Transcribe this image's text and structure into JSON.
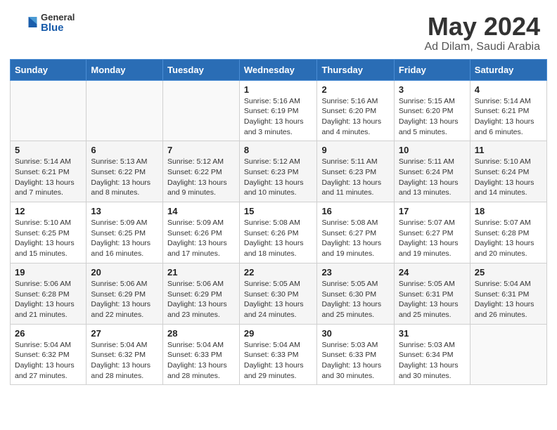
{
  "header": {
    "logo_general": "General",
    "logo_blue": "Blue",
    "title": "May 2024",
    "subtitle": "Ad Dilam, Saudi Arabia"
  },
  "days_of_week": [
    "Sunday",
    "Monday",
    "Tuesday",
    "Wednesday",
    "Thursday",
    "Friday",
    "Saturday"
  ],
  "weeks": [
    [
      {
        "day": "",
        "info": ""
      },
      {
        "day": "",
        "info": ""
      },
      {
        "day": "",
        "info": ""
      },
      {
        "day": "1",
        "info": "Sunrise: 5:16 AM\nSunset: 6:19 PM\nDaylight: 13 hours and 3 minutes."
      },
      {
        "day": "2",
        "info": "Sunrise: 5:16 AM\nSunset: 6:20 PM\nDaylight: 13 hours and 4 minutes."
      },
      {
        "day": "3",
        "info": "Sunrise: 5:15 AM\nSunset: 6:20 PM\nDaylight: 13 hours and 5 minutes."
      },
      {
        "day": "4",
        "info": "Sunrise: 5:14 AM\nSunset: 6:21 PM\nDaylight: 13 hours and 6 minutes."
      }
    ],
    [
      {
        "day": "5",
        "info": "Sunrise: 5:14 AM\nSunset: 6:21 PM\nDaylight: 13 hours and 7 minutes."
      },
      {
        "day": "6",
        "info": "Sunrise: 5:13 AM\nSunset: 6:22 PM\nDaylight: 13 hours and 8 minutes."
      },
      {
        "day": "7",
        "info": "Sunrise: 5:12 AM\nSunset: 6:22 PM\nDaylight: 13 hours and 9 minutes."
      },
      {
        "day": "8",
        "info": "Sunrise: 5:12 AM\nSunset: 6:23 PM\nDaylight: 13 hours and 10 minutes."
      },
      {
        "day": "9",
        "info": "Sunrise: 5:11 AM\nSunset: 6:23 PM\nDaylight: 13 hours and 11 minutes."
      },
      {
        "day": "10",
        "info": "Sunrise: 5:11 AM\nSunset: 6:24 PM\nDaylight: 13 hours and 13 minutes."
      },
      {
        "day": "11",
        "info": "Sunrise: 5:10 AM\nSunset: 6:24 PM\nDaylight: 13 hours and 14 minutes."
      }
    ],
    [
      {
        "day": "12",
        "info": "Sunrise: 5:10 AM\nSunset: 6:25 PM\nDaylight: 13 hours and 15 minutes."
      },
      {
        "day": "13",
        "info": "Sunrise: 5:09 AM\nSunset: 6:25 PM\nDaylight: 13 hours and 16 minutes."
      },
      {
        "day": "14",
        "info": "Sunrise: 5:09 AM\nSunset: 6:26 PM\nDaylight: 13 hours and 17 minutes."
      },
      {
        "day": "15",
        "info": "Sunrise: 5:08 AM\nSunset: 6:26 PM\nDaylight: 13 hours and 18 minutes."
      },
      {
        "day": "16",
        "info": "Sunrise: 5:08 AM\nSunset: 6:27 PM\nDaylight: 13 hours and 19 minutes."
      },
      {
        "day": "17",
        "info": "Sunrise: 5:07 AM\nSunset: 6:27 PM\nDaylight: 13 hours and 19 minutes."
      },
      {
        "day": "18",
        "info": "Sunrise: 5:07 AM\nSunset: 6:28 PM\nDaylight: 13 hours and 20 minutes."
      }
    ],
    [
      {
        "day": "19",
        "info": "Sunrise: 5:06 AM\nSunset: 6:28 PM\nDaylight: 13 hours and 21 minutes."
      },
      {
        "day": "20",
        "info": "Sunrise: 5:06 AM\nSunset: 6:29 PM\nDaylight: 13 hours and 22 minutes."
      },
      {
        "day": "21",
        "info": "Sunrise: 5:06 AM\nSunset: 6:29 PM\nDaylight: 13 hours and 23 minutes."
      },
      {
        "day": "22",
        "info": "Sunrise: 5:05 AM\nSunset: 6:30 PM\nDaylight: 13 hours and 24 minutes."
      },
      {
        "day": "23",
        "info": "Sunrise: 5:05 AM\nSunset: 6:30 PM\nDaylight: 13 hours and 25 minutes."
      },
      {
        "day": "24",
        "info": "Sunrise: 5:05 AM\nSunset: 6:31 PM\nDaylight: 13 hours and 25 minutes."
      },
      {
        "day": "25",
        "info": "Sunrise: 5:04 AM\nSunset: 6:31 PM\nDaylight: 13 hours and 26 minutes."
      }
    ],
    [
      {
        "day": "26",
        "info": "Sunrise: 5:04 AM\nSunset: 6:32 PM\nDaylight: 13 hours and 27 minutes."
      },
      {
        "day": "27",
        "info": "Sunrise: 5:04 AM\nSunset: 6:32 PM\nDaylight: 13 hours and 28 minutes."
      },
      {
        "day": "28",
        "info": "Sunrise: 5:04 AM\nSunset: 6:33 PM\nDaylight: 13 hours and 28 minutes."
      },
      {
        "day": "29",
        "info": "Sunrise: 5:04 AM\nSunset: 6:33 PM\nDaylight: 13 hours and 29 minutes."
      },
      {
        "day": "30",
        "info": "Sunrise: 5:03 AM\nSunset: 6:33 PM\nDaylight: 13 hours and 30 minutes."
      },
      {
        "day": "31",
        "info": "Sunrise: 5:03 AM\nSunset: 6:34 PM\nDaylight: 13 hours and 30 minutes."
      },
      {
        "day": "",
        "info": ""
      }
    ]
  ]
}
